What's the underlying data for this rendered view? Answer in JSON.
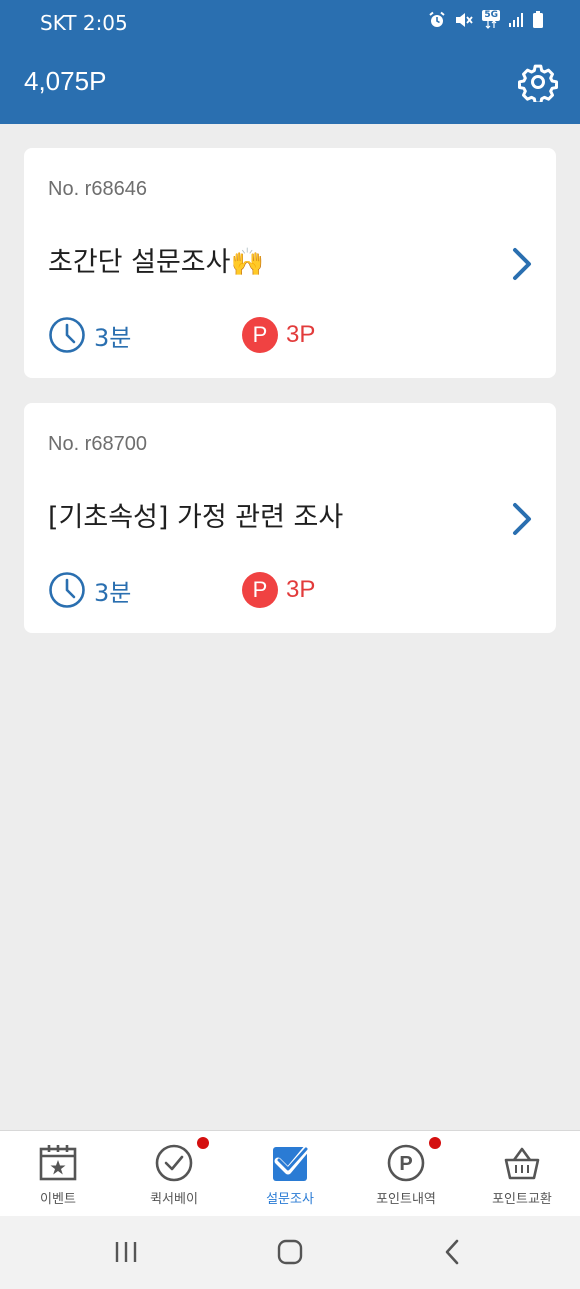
{
  "status_bar": {
    "carrier": "SKT",
    "time": "2:05",
    "icons": [
      "alarm-icon",
      "mute-icon",
      "5g-icon",
      "signal-icon",
      "battery-icon"
    ],
    "network": "5G"
  },
  "app_bar": {
    "points": "4,075P",
    "settings_icon": "gear-icon"
  },
  "surveys": [
    {
      "number": "No. r68646",
      "title": "초간단 설문조사🙌",
      "duration": "3분",
      "reward_badge": "P",
      "reward": "3P"
    },
    {
      "number": "No. r68700",
      "title": "[기초속성] 가정 관련 조사",
      "duration": "3분",
      "reward_badge": "P",
      "reward": "3P"
    }
  ],
  "bottom_nav": {
    "items": [
      {
        "label": "이벤트",
        "icon": "calendar-star-icon",
        "badge": false,
        "active": false
      },
      {
        "label": "퀵서베이",
        "icon": "check-circle-icon",
        "badge": true,
        "active": false
      },
      {
        "label": "설문조사",
        "icon": "checkbox-icon",
        "badge": false,
        "active": true
      },
      {
        "label": "포인트내역",
        "icon": "point-circle-icon",
        "badge": true,
        "active": false
      },
      {
        "label": "포인트교환",
        "icon": "basket-icon",
        "badge": false,
        "active": false
      }
    ],
    "point_icon_letter": "P"
  },
  "system_nav": {
    "icons": [
      "recent-apps-icon",
      "home-icon",
      "back-icon"
    ]
  },
  "colors": {
    "primary": "#2a6fb0",
    "active_nav": "#2a7bd4",
    "reward_red": "#f04242",
    "badge_dot": "#d40f0f",
    "background": "#ededed"
  }
}
